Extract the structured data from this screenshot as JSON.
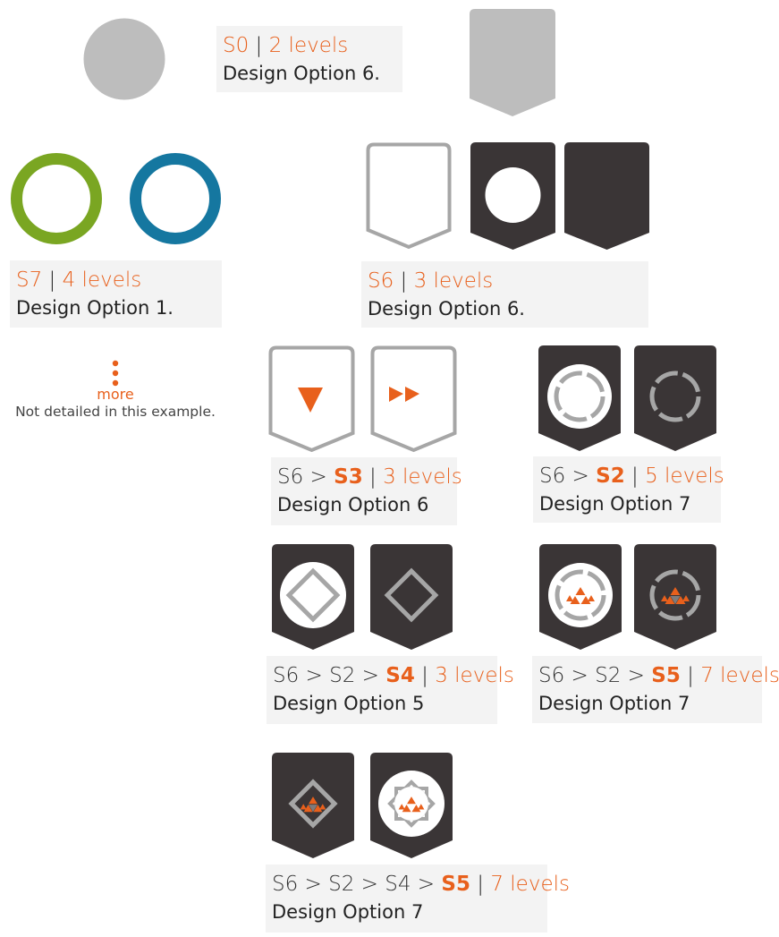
{
  "colors": {
    "accent": "#e8601c",
    "dark": "#3a3536",
    "gray": "#a6a6a6",
    "placeholder": "#bdbdbd",
    "green": "#7aa622",
    "blue": "#1577a0",
    "card": "#f3f3f3"
  },
  "s0": {
    "code": "S0",
    "sep": "|",
    "levels": "2 levels",
    "design": "Design  Option 6."
  },
  "s7": {
    "code": "S7",
    "sep": "|",
    "levels": "4 levels",
    "design": "Design  Option 1."
  },
  "s6": {
    "code": "S6",
    "sep": "|",
    "levels": "3 levels",
    "design": "Design  Option 6."
  },
  "more": {
    "dots": "⋮",
    "label": "more",
    "note": "Not detailed in this example."
  },
  "s6_s3": {
    "prefix": "S6 > ",
    "code": "S3",
    "sep": "|",
    "levels": "3 levels",
    "design": "Design Option 6"
  },
  "s6_s2": {
    "prefix": "S6 > ",
    "code": "S2",
    "sep": "|",
    "levels": "5 levels",
    "design": "Design Option 7"
  },
  "s6_s2_s4": {
    "prefix": "S6 > S2 > ",
    "code": "S4",
    "sep": "|",
    "levels": "3 levels",
    "design": "Design Option 5"
  },
  "s6_s2_s5": {
    "prefix": "S6 > S2 > ",
    "code": "S5",
    "sep": "|",
    "levels": "7 levels",
    "design": "Design Option 7"
  },
  "s6_s2_s4_s5": {
    "prefix": "S6 > S2 > S4 > ",
    "code": "S5",
    "sep": "|",
    "levels": "7 levels",
    "design": "Design Option 7"
  }
}
